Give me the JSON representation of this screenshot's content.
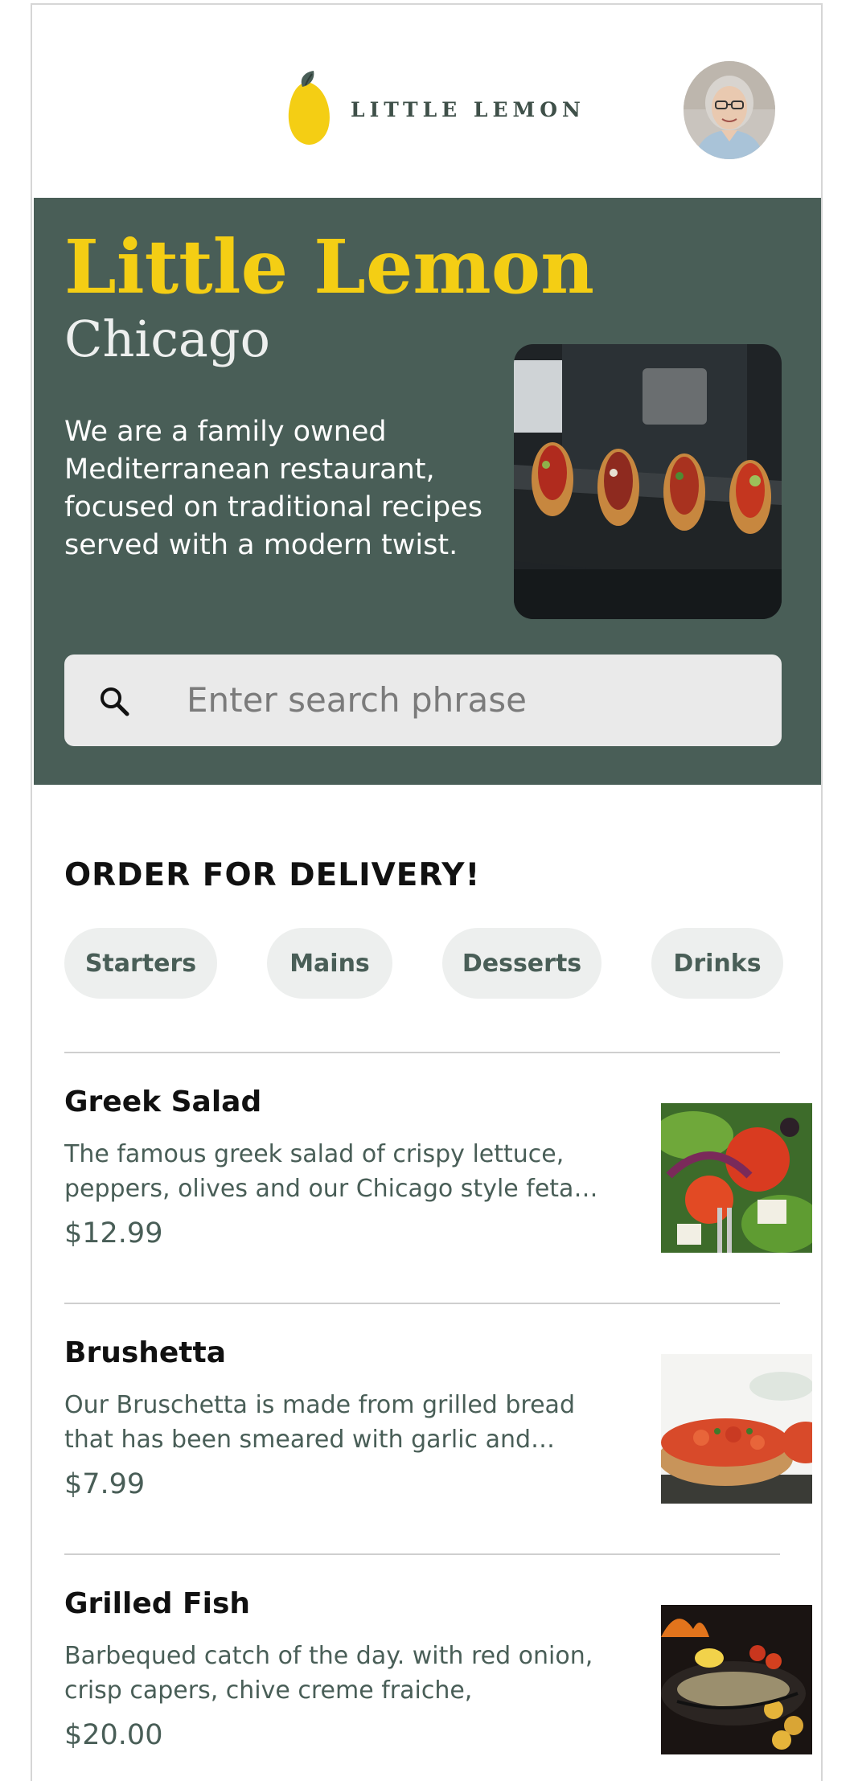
{
  "brand": {
    "logo_text": "LITTLE LEMON",
    "primary": "#495e57",
    "accent": "#f4ce14"
  },
  "header": {
    "avatar_alt": "profile-avatar"
  },
  "hero": {
    "title": "Little Lemon",
    "city": "Chicago",
    "description": "We are a family owned Mediterranean restaurant, focused on traditional recipes served with a modern twist."
  },
  "search": {
    "placeholder": "Enter search phrase",
    "icon": "search-icon"
  },
  "delivery": {
    "title": "ORDER FOR DELIVERY!",
    "categories": [
      "Starters",
      "Mains",
      "Desserts",
      "Drinks"
    ]
  },
  "menu": {
    "items": [
      {
        "name": "Greek Salad",
        "description": "The famous greek salad of crispy lettuce, peppers, olives and our Chicago style feta cheese, garnished with crunchy garlic and rosemary croutons.",
        "price": "$12.99"
      },
      {
        "name": "Brushetta",
        "description": "Our Bruschetta is made from grilled bread that has been smeared with garlic and seasoned with salt and olive oil.",
        "price": "$7.99"
      },
      {
        "name": "Grilled Fish",
        "description": "Barbequed catch of the day. with red onion, crisp capers, chive creme fraiche,",
        "price": "$20.00"
      }
    ]
  }
}
